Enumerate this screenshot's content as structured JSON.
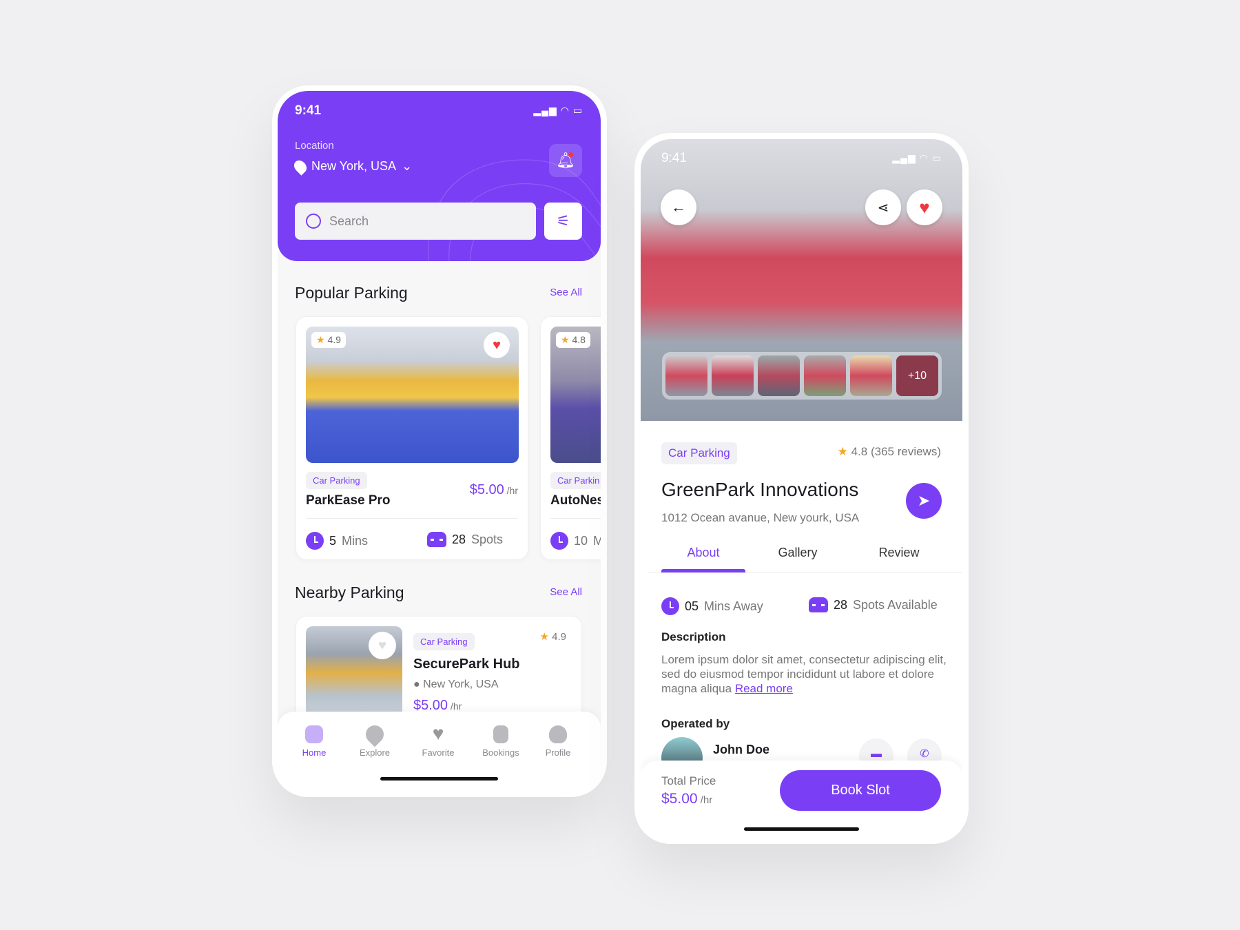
{
  "colors": {
    "accent": "#7a3ff5",
    "favorite": "#f0383e",
    "star": "#f5a623"
  },
  "home": {
    "status_time": "9:41",
    "location_label": "Location",
    "location_value": "New York, USA",
    "search_placeholder": "Search",
    "popular": {
      "title": "Popular Parking",
      "see_all": "See All",
      "cards": [
        {
          "rating": "4.9",
          "tag": "Car Parking",
          "name": "ParkEase Pro",
          "price": "$5.00",
          "unit": "/hr",
          "time_num": "5",
          "time_unit": "Mins",
          "spots_num": "28",
          "spots_unit": "Spots",
          "favorite": true
        },
        {
          "rating": "4.8",
          "tag": "Car Parkin",
          "name": "AutoNes",
          "time_num": "10",
          "time_unit": "M"
        }
      ]
    },
    "nearby": {
      "title": "Nearby Parking",
      "see_all": "See All",
      "cards": [
        {
          "tag": "Car Parking",
          "rating": "4.9",
          "name": "SecurePark Hub",
          "location": "New York, USA",
          "price": "$5.00",
          "unit": "/hr"
        }
      ]
    },
    "nav": [
      {
        "label": "Home",
        "icon": "home-icon",
        "active": true
      },
      {
        "label": "Explore",
        "icon": "map-pin-icon"
      },
      {
        "label": "Favorite",
        "icon": "heart-icon"
      },
      {
        "label": "Bookings",
        "icon": "clipboard-icon"
      },
      {
        "label": "Profile",
        "icon": "user-icon"
      }
    ]
  },
  "detail": {
    "status_time": "9:41",
    "more_photos": "+10",
    "tag": "Car Parking",
    "rating": "4.8 (365 reviews)",
    "name": "GreenPark Innovations",
    "address": "1012 Ocean avanue, New yourk, USA",
    "tabs": [
      "About",
      "Gallery",
      "Review"
    ],
    "active_tab": "About",
    "time_num": "05",
    "time_text": "Mins Away",
    "spots_num": "28",
    "spots_text": "Spots Available",
    "description_title": "Description",
    "description": "Lorem ipsum dolor sit amet, consectetur adipiscing elit, sed do eiusmod tempor incididunt ut labore et dolore magna aliqua",
    "read_more": "Read more",
    "operated_by": "Operated by",
    "operator": "John Doe",
    "total_label": "Total Price",
    "price": "$5.00",
    "unit": "/hr",
    "book_button": "Book Slot"
  }
}
